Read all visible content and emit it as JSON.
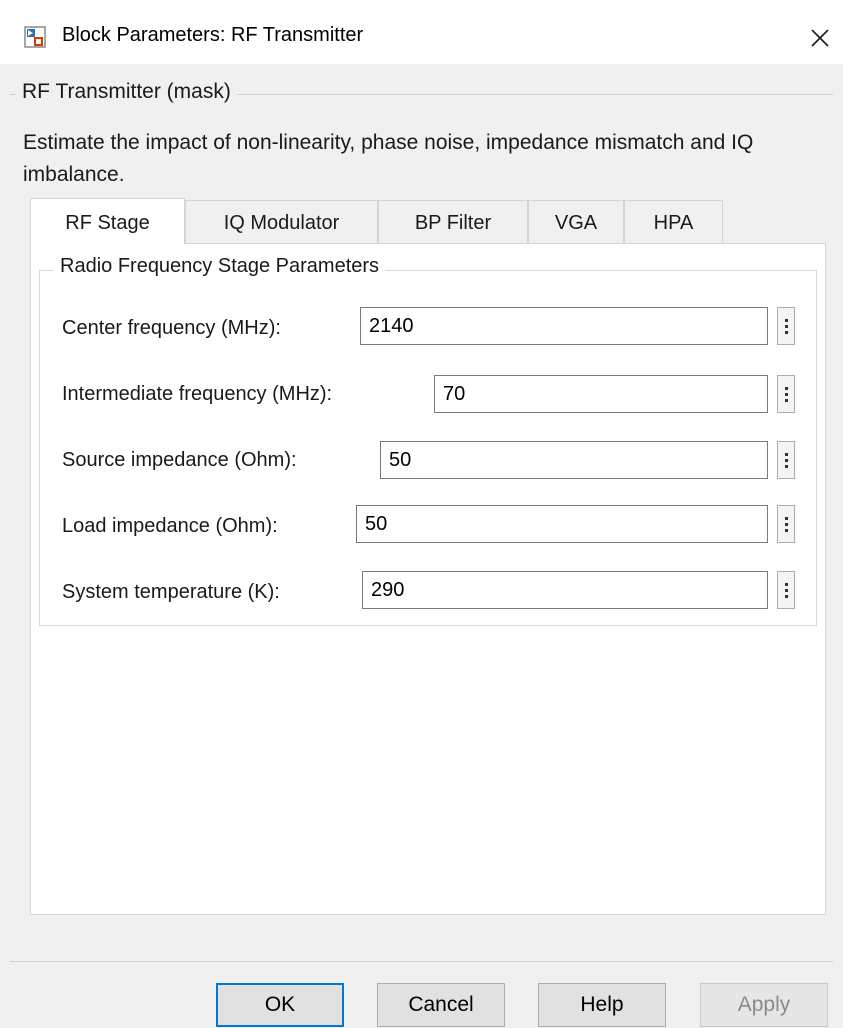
{
  "window": {
    "title": "Block Parameters: RF Transmitter",
    "icon": "simulink-block-icon",
    "close_icon": "close-icon"
  },
  "mask": {
    "title": "RF Transmitter (mask)",
    "description": "Estimate the impact of non-linearity, phase noise, impedance mismatch and IQ imbalance."
  },
  "tabs": [
    {
      "label": "RF Stage",
      "active": true
    },
    {
      "label": "IQ Modulator",
      "active": false
    },
    {
      "label": "BP Filter",
      "active": false
    },
    {
      "label": "VGA",
      "active": false
    },
    {
      "label": "HPA",
      "active": false
    }
  ],
  "group": {
    "title": "Radio Frequency Stage Parameters",
    "params": [
      {
        "label": "Center frequency (MHz):",
        "value": "2140"
      },
      {
        "label": "Intermediate frequency (MHz):",
        "value": "70"
      },
      {
        "label": "Source impedance (Ohm):",
        "value": "50"
      },
      {
        "label": "Load impedance (Ohm):",
        "value": "50"
      },
      {
        "label": "System temperature (K):",
        "value": "290"
      }
    ]
  },
  "buttons": {
    "ok": "OK",
    "cancel": "Cancel",
    "help": "Help",
    "apply": "Apply"
  },
  "colors": {
    "accent": "#0078d7",
    "background": "#f0f0f0",
    "panel": "#ffffff"
  }
}
